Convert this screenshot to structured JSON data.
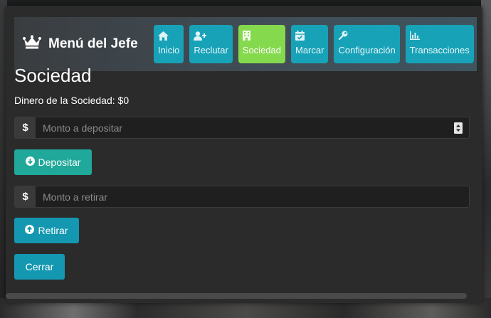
{
  "brand": {
    "title": "Menú del Jefe",
    "icon": "crown-icon"
  },
  "tabs": [
    {
      "label": "Inicio",
      "icon": "home-icon",
      "active": false
    },
    {
      "label": "Reclutar",
      "icon": "user-plus-icon",
      "active": false
    },
    {
      "label": "Sociedad",
      "icon": "building-icon",
      "active": true
    },
    {
      "label": "Marcar",
      "icon": "calendar-check-icon",
      "active": false
    },
    {
      "label": "Configuración",
      "icon": "wrench-icon",
      "active": false
    },
    {
      "label": "Transacciones",
      "icon": "chart-bar-icon",
      "active": false
    }
  ],
  "main": {
    "title": "Sociedad",
    "balance_text": "Dinero de la Sociedad: $0",
    "deposit": {
      "addon": "$",
      "value": "",
      "placeholder": "Monto a depositar",
      "button_label": "Depositar",
      "button_icon": "arrow-circle-down-icon"
    },
    "withdraw": {
      "addon": "$",
      "value": "",
      "placeholder": "Monto a retirar",
      "button_label": "Retirar",
      "button_icon": "arrow-circle-up-icon"
    },
    "close_label": "Cerrar"
  },
  "colors": {
    "tab": "#17a2b8",
    "tab_active": "#84d94d",
    "deposit_button": "#20a89a",
    "withdraw_button": "#1497b0",
    "panel": "#2b2b2b"
  }
}
